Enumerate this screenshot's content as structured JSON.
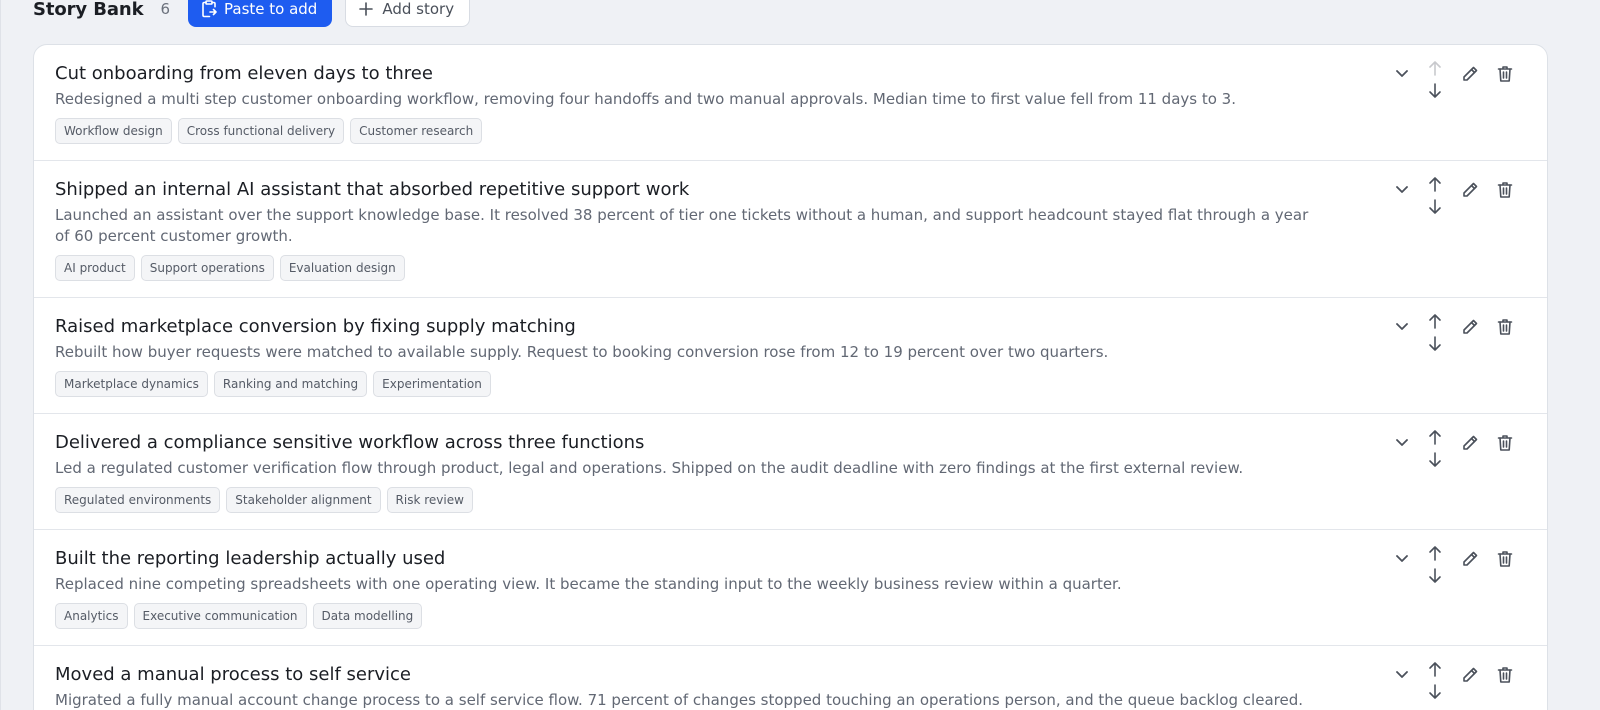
{
  "header": {
    "title": "Story Bank",
    "count": "6",
    "paste_label": "Paste to add",
    "add_label": "Add story",
    "icons": {
      "paste": "clipboard-icon",
      "add": "plus-icon"
    },
    "colors": {
      "primary": "#1e5cf0"
    }
  },
  "stories": [
    {
      "title": "Cut onboarding from eleven days to three",
      "description": "Redesigned a multi step customer onboarding workflow, removing four handoffs and two manual approvals. Median time to first value fell from 11 days to 3.",
      "tags": [
        "Workflow design",
        "Cross functional delivery",
        "Customer research"
      ],
      "move_up_enabled": false
    },
    {
      "title": "Shipped an internal AI assistant that absorbed repetitive support work",
      "description": "Launched an assistant over the support knowledge base. It resolved 38 percent of tier one tickets without a human, and support headcount stayed flat through a year of 60 percent customer growth.",
      "tags": [
        "AI product",
        "Support operations",
        "Evaluation design"
      ],
      "move_up_enabled": true
    },
    {
      "title": "Raised marketplace conversion by fixing supply matching",
      "description": "Rebuilt how buyer requests were matched to available supply. Request to booking conversion rose from 12 to 19 percent over two quarters.",
      "tags": [
        "Marketplace dynamics",
        "Ranking and matching",
        "Experimentation"
      ],
      "move_up_enabled": true
    },
    {
      "title": "Delivered a compliance sensitive workflow across three functions",
      "description": "Led a regulated customer verification flow through product, legal and operations. Shipped on the audit deadline with zero findings at the first external review.",
      "tags": [
        "Regulated environments",
        "Stakeholder alignment",
        "Risk review"
      ],
      "move_up_enabled": true
    },
    {
      "title": "Built the reporting leadership actually used",
      "description": "Replaced nine competing spreadsheets with one operating view. It became the standing input to the weekly business review within a quarter.",
      "tags": [
        "Analytics",
        "Executive communication",
        "Data modelling"
      ],
      "move_up_enabled": true
    },
    {
      "title": "Moved a manual process to self service",
      "description": "Migrated a fully manual account change process to a self service flow. 71 percent of changes stopped touching an operations person, and the queue backlog cleared.",
      "tags": [],
      "move_up_enabled": true
    }
  ],
  "row_actions": {
    "icons": [
      "chevron-down-icon",
      "arrow-up-icon",
      "arrow-down-icon",
      "pencil-icon",
      "trash-icon"
    ]
  }
}
